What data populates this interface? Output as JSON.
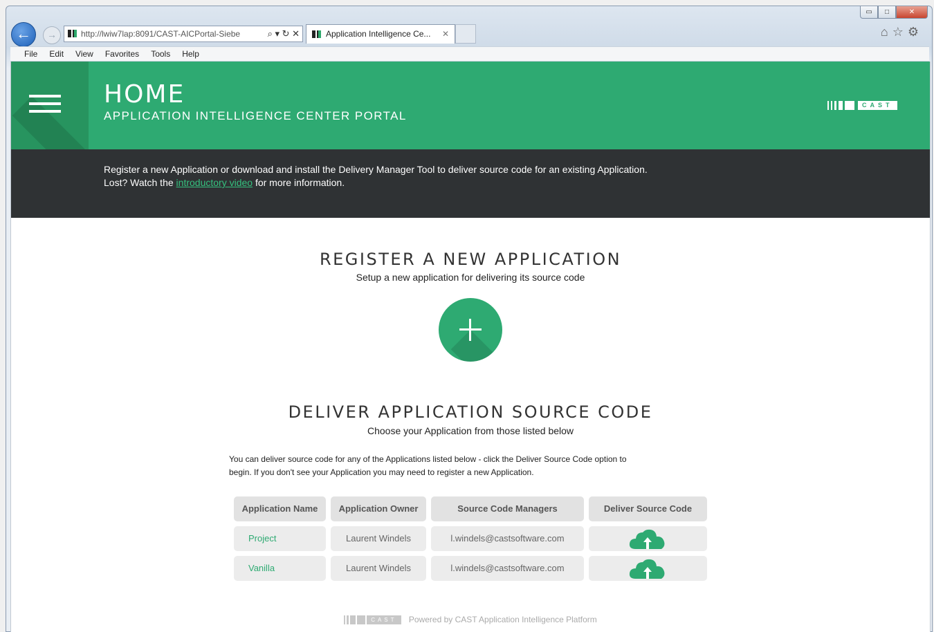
{
  "browser": {
    "address_url": "http://lwiw7lap:8091/CAST-AICPortal-Siebe",
    "address_icons": "⌕ ▾ ↻ ✕",
    "tab_title": "Application Intelligence Ce...",
    "tab_close": "✕",
    "window_buttons": {
      "minimize": "▭",
      "maximize": "□",
      "close": "✕"
    },
    "menu": [
      "File",
      "Edit",
      "View",
      "Favorites",
      "Tools",
      "Help"
    ],
    "icons": [
      "home-icon",
      "star-icon",
      "gear-icon"
    ]
  },
  "hero": {
    "title": "HOME",
    "subtitle": "APPLICATION INTELLIGENCE CENTER PORTAL",
    "logo_text": "CAST",
    "color": "#2eaa72"
  },
  "banner": {
    "line1": "Register a new Application or download and install the Delivery Manager Tool to deliver source code for an existing Application.",
    "line2_prefix": "Lost? Watch the ",
    "line2_link": "introductory video",
    "line2_suffix": " for more information."
  },
  "register": {
    "title": "REGISTER A NEW APPLICATION",
    "subtitle": "Setup a new application for delivering its source code",
    "button_icon": "plus-icon"
  },
  "deliver": {
    "title": "DELIVER APPLICATION SOURCE CODE",
    "subtitle": "Choose your Application from those listed below",
    "intro_line1": "You can deliver source code for any of the Applications listed below - click the Deliver Source Code option to",
    "intro_line2": "begin. If you don't see your Application you may need to register a new Application.",
    "columns": [
      "Application Name",
      "Application Owner",
      "Source Code Managers",
      "Deliver Source Code"
    ],
    "rows": [
      {
        "name": "Project",
        "owner": "Laurent Windels",
        "managers": "l.windels@castsoftware.com",
        "action_icon": "cloud-upload-icon"
      },
      {
        "name": "Vanilla",
        "owner": "Laurent Windels",
        "managers": "l.windels@castsoftware.com",
        "action_icon": "cloud-upload-icon"
      }
    ]
  },
  "footer": {
    "logo_text": "CAST",
    "text": "Powered by CAST Application Intelligence Platform"
  }
}
